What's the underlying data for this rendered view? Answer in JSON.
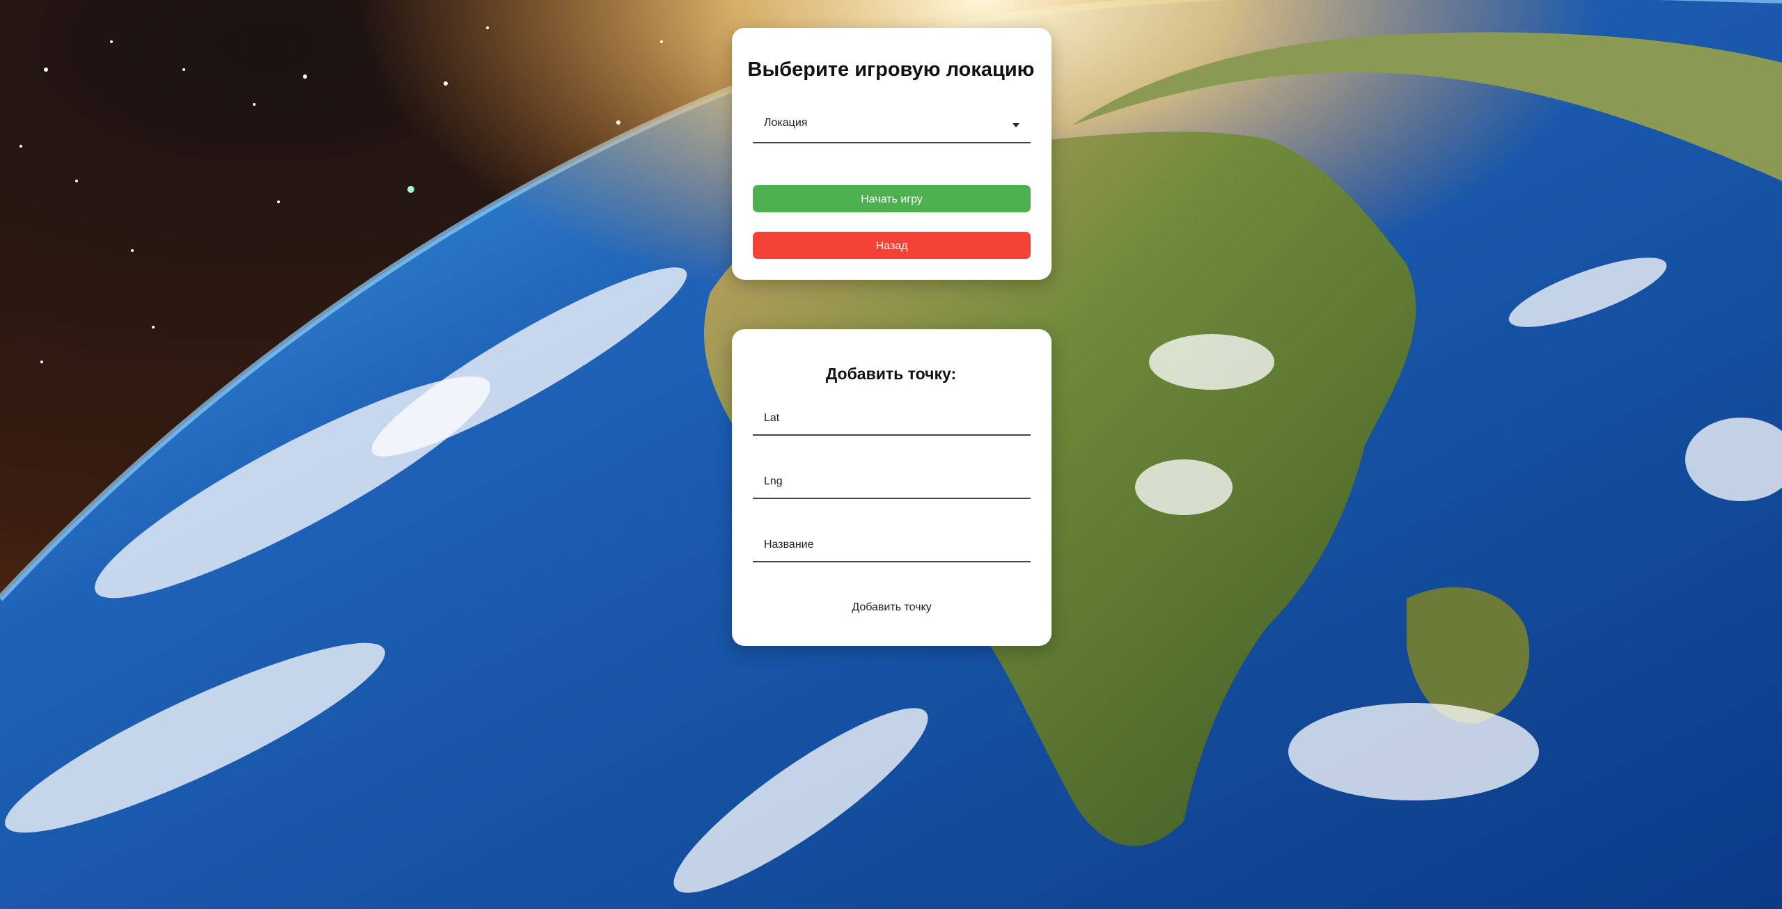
{
  "location_panel": {
    "title": "Выберите игровую локацию",
    "select_value": "Локация",
    "start_button": "Начать игру",
    "back_button": "Назад"
  },
  "add_point_panel": {
    "title": "Добавить точку:",
    "lat_placeholder": "Lat",
    "lng_placeholder": "Lng",
    "name_placeholder": "Название",
    "submit_label": "Добавить точку"
  },
  "colors": {
    "start_button": "#4caf50",
    "back_button": "#f44336",
    "panel_background": "#ffffff"
  },
  "icons": {
    "select_caret": "caret-down-icon"
  }
}
